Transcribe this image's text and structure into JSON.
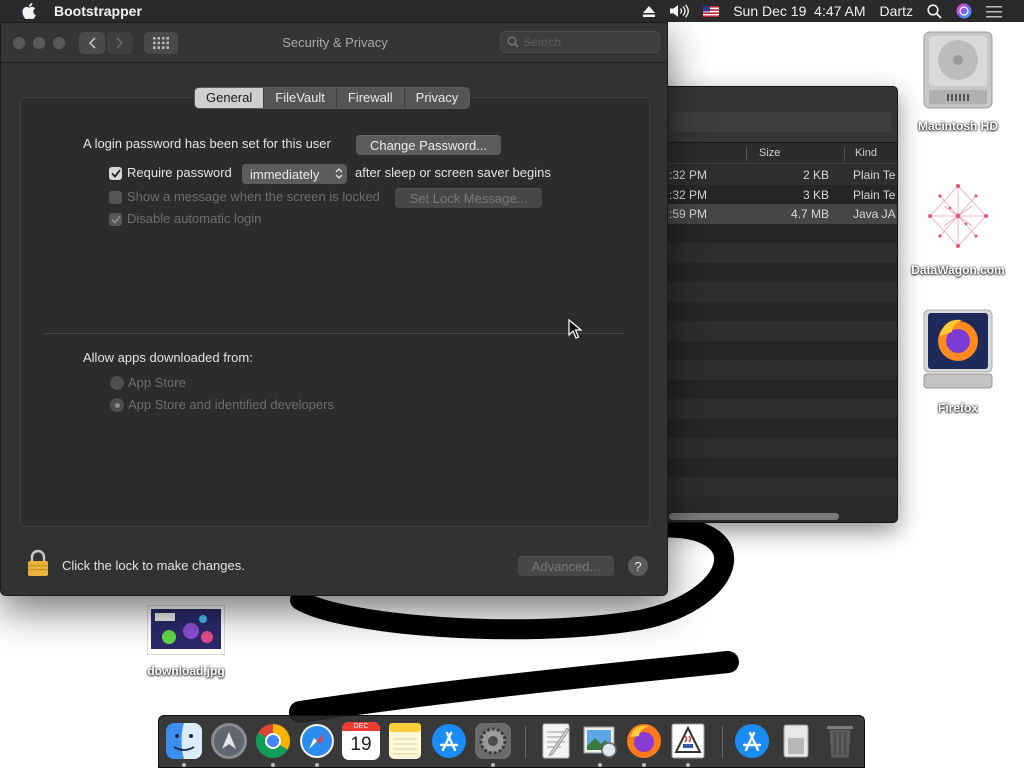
{
  "menubar": {
    "app_name": "Bootstrapper",
    "date": "Sun Dec 19",
    "time": "4:47 AM",
    "user": "Dartz",
    "icons": [
      "apple-icon",
      "eject-icon",
      "volume-icon",
      "us-flag-icon",
      "search-icon",
      "siri-icon",
      "control-center-icon"
    ]
  },
  "window": {
    "title": "Security & Privacy",
    "search_placeholder": "Search",
    "tabs": [
      "General",
      "FileVault",
      "Firewall",
      "Privacy"
    ],
    "active_tab": "General",
    "general": {
      "login_password_text": "A login password has been set for this user",
      "change_password_button": "Change Password...",
      "require_password_label": "Require password",
      "require_password_checked": true,
      "require_password_value": "immediately",
      "after_sleep_text": "after sleep or screen saver begins",
      "show_message_label": "Show a message when the screen is locked",
      "show_message_checked": false,
      "set_lock_message_button": "Set Lock Message...",
      "disable_auto_login_label": "Disable automatic login",
      "disable_auto_login_checked": true,
      "allow_apps_label": "Allow apps downloaded from:",
      "radio_options": [
        "App Store",
        "App Store and identified developers"
      ],
      "radio_selected": "App Store and identified developers"
    },
    "footer": {
      "lock_text": "Click the lock to make changes.",
      "advanced_button": "Advanced...",
      "help_label": "?"
    }
  },
  "finder": {
    "columns": {
      "size": "Size",
      "kind": "Kind"
    },
    "rows": [
      {
        "date": ":32 PM",
        "size": "2 KB",
        "kind": "Plain Te"
      },
      {
        "date": ":32 PM",
        "size": "3 KB",
        "kind": "Plain Te"
      },
      {
        "date": ":59 PM",
        "size": "4.7 MB",
        "kind": "Java JA"
      }
    ]
  },
  "desktop": {
    "icons": [
      {
        "label": "Macintosh HD"
      },
      {
        "label": "DataWagon.com"
      },
      {
        "label": "Firefox"
      },
      {
        "label": "download.jpg"
      }
    ]
  },
  "dock": {
    "calendar_month": "DEC",
    "calendar_day": "19",
    "apps": [
      "Finder",
      "Launchpad",
      "Google Chrome",
      "Safari",
      "Calendar",
      "Notes",
      "App Store",
      "System Preferences",
      "TextEdit",
      "Preview",
      "Firefox",
      "Java Launcher",
      "Downloads",
      "Documents",
      "Trash"
    ]
  },
  "colors": {
    "accent": "#d8d8d8",
    "lock_gold": "#e8b33a",
    "window_bg": "#323232",
    "menubar_bg": "#2a2a2c"
  }
}
